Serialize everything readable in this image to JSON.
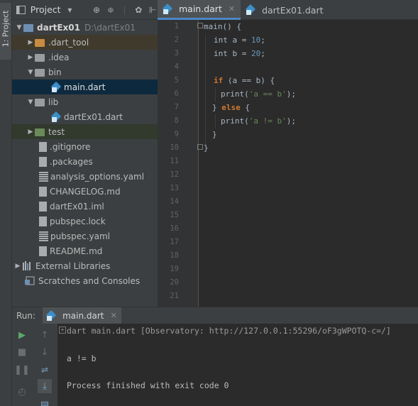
{
  "stripe": {
    "tab_label": "1: Project"
  },
  "project_panel": {
    "title": "Project",
    "icons": [
      "dropdown-arrow-icon",
      "locate-icon",
      "collapse-icon",
      "gear-icon",
      "hide-icon"
    ],
    "tree": [
      {
        "label": "dartEx01",
        "path": "D:\\dartEx01",
        "type": "module",
        "expanded": true
      },
      {
        "label": ".dart_tool",
        "type": "folder-orange",
        "expanded": false
      },
      {
        "label": ".idea",
        "type": "folder",
        "expanded": false
      },
      {
        "label": "bin",
        "type": "folder",
        "expanded": true
      },
      {
        "label": "main.dart",
        "type": "dart",
        "selected": true
      },
      {
        "label": "lib",
        "type": "folder",
        "expanded": true
      },
      {
        "label": "dartEx01.dart",
        "type": "dart"
      },
      {
        "label": "test",
        "type": "folder-green",
        "expanded": false
      },
      {
        "label": ".gitignore",
        "type": "file"
      },
      {
        "label": ".packages",
        "type": "file"
      },
      {
        "label": "analysis_options.yaml",
        "type": "grid"
      },
      {
        "label": "CHANGELOG.md",
        "type": "file"
      },
      {
        "label": "dartEx01.iml",
        "type": "file"
      },
      {
        "label": "pubspec.lock",
        "type": "file"
      },
      {
        "label": "pubspec.yaml",
        "type": "grid"
      },
      {
        "label": "README.md",
        "type": "file"
      },
      {
        "label": "External Libraries",
        "type": "libs",
        "expanded": false
      },
      {
        "label": "Scratches and Consoles",
        "type": "scratch"
      }
    ]
  },
  "editor": {
    "tabs": [
      {
        "label": "main.dart",
        "active": true
      },
      {
        "label": "dartEx01.dart",
        "active": false
      }
    ],
    "line_numbers": [
      "1",
      "2",
      "3",
      "4",
      "5",
      "6",
      "7",
      "8",
      "9",
      "10",
      "11",
      "12",
      "13",
      "14",
      "15",
      "16",
      "17",
      "18",
      "19",
      "20",
      "21"
    ],
    "code": {
      "l1": "main() {",
      "l2_kw": "int",
      "l2_a": " a = ",
      "l2_n": "10",
      "l2_e": ";",
      "l3_kw": "int",
      "l3_a": " b = ",
      "l3_n": "20",
      "l3_e": ";",
      "l5_kw": "if",
      "l5_rest": " (a == b) {",
      "l6_a": "print(",
      "l6_s": "'a == b'",
      "l6_e": ");",
      "l7_a": "} ",
      "l7_kw": "else",
      "l7_e": " {",
      "l8_a": "print(",
      "l8_s": "'a != b'",
      "l8_e": ");",
      "l9": "}",
      "l10": "}"
    }
  },
  "run_panel": {
    "label": "Run:",
    "tab_label": "main.dart",
    "console": {
      "cmd": "dart main.dart [Observatory: http://127.0.0.1:55296/oF3gWPOTQ-c=/]",
      "output": "a != b",
      "exit": "Process finished with exit code 0"
    }
  },
  "colors": {
    "accent": "#4a88c7",
    "keyword": "#cc7832",
    "number": "#6897bb",
    "string": "#6a8759",
    "link": "#287bde",
    "run_green": "#59a869"
  }
}
